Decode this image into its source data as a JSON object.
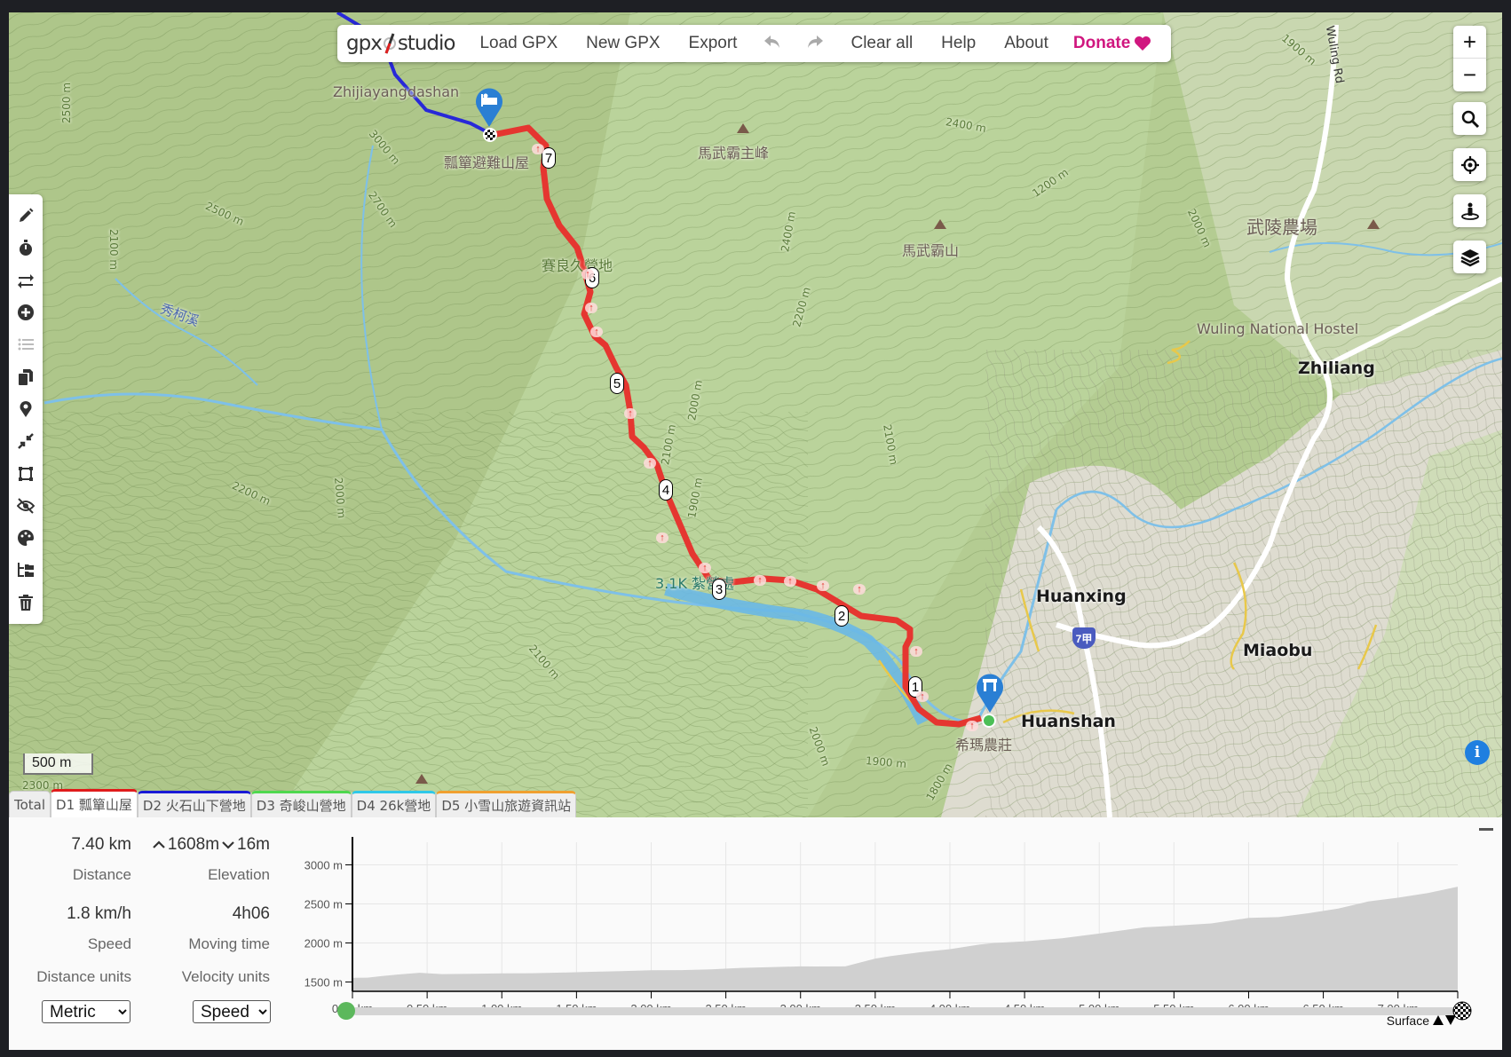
{
  "app": {
    "name_left": "gpx",
    "name_right": "studio"
  },
  "menu": {
    "load": "Load GPX",
    "new": "New GPX",
    "export": "Export",
    "undo_icon": "undo-icon",
    "redo_icon": "redo-icon",
    "clear": "Clear all",
    "help": "Help",
    "about": "About",
    "donate": "Donate",
    "donate_icon": "heart-icon",
    "donate_color": "#d0177f"
  },
  "toolbar": [
    {
      "name": "pencil-icon",
      "label": "Edit route"
    },
    {
      "name": "stopwatch-icon",
      "label": "Time"
    },
    {
      "name": "reverse-icon",
      "label": "Reverse"
    },
    {
      "name": "add-circle-icon",
      "label": "Add"
    },
    {
      "name": "list-icon",
      "label": "List",
      "disabled": true
    },
    {
      "name": "copy-icon",
      "label": "Duplicate"
    },
    {
      "name": "map-pin-icon",
      "label": "Waypoint"
    },
    {
      "name": "compress-icon",
      "label": "Reduce"
    },
    {
      "name": "crop-icon",
      "label": "Crop"
    },
    {
      "name": "eye-slash-icon",
      "label": "Hide"
    },
    {
      "name": "palette-icon",
      "label": "Style"
    },
    {
      "name": "folder-tree-icon",
      "label": "Structure"
    },
    {
      "name": "trash-icon",
      "label": "Delete"
    }
  ],
  "map_controls": {
    "zoom_in": "+",
    "zoom_out": "−",
    "search_icon": "search-icon",
    "locate_icon": "locate-icon",
    "streetview_icon": "person-icon",
    "layers_icon": "layers-icon",
    "info_icon": "i"
  },
  "scale": "500 m",
  "map_labels": {
    "zhijiayangdashan": "Zhijiayangdashan",
    "hut": "瓢簞避難山屋",
    "mawuba_main": "馬武霸主峰",
    "mawuba": "馬武霸山",
    "wuling_farm": "武陵農場",
    "wuling_hostel": "Wuling National Hostel",
    "zhiliang": "Zhiliang",
    "huanxing": "Huanxing",
    "miaobu": "Miaobu",
    "huanshan": "Huanshan",
    "ximanongzhuang": "希瑪農莊",
    "sailiang_camp": "賽良久營地",
    "km31": "3.1K 紮營處",
    "xiukexi": "秀柯溪",
    "wuling_rd": "Wuling Rd",
    "hwy": "7甲",
    "contours": [
      "2500 m",
      "3000 m",
      "2700 m",
      "2500 m",
      "2100 m",
      "2400 m",
      "1200 m",
      "2000 m",
      "2400 m",
      "2200 m",
      "2000 m",
      "2100 m",
      "1900 m",
      "2100 m",
      "2200 m",
      "2000 m",
      "2100 m",
      "2000 m",
      "1900 m",
      "1800 m",
      "1900 m",
      "2300 m"
    ]
  },
  "route_markers": [
    "1",
    "2",
    "3",
    "4",
    "5",
    "6",
    "7"
  ],
  "tabs": [
    {
      "label": "Total",
      "color": null
    },
    {
      "label": "D1 瓢簞山屋",
      "color": "#e01b1b",
      "active": true
    },
    {
      "label": "D2 火石山下營地",
      "color": "#1a1ad6"
    },
    {
      "label": "D3 奇峻山營地",
      "color": "#4ed84e"
    },
    {
      "label": "D4 26k營地",
      "color": "#2fc8e8"
    },
    {
      "label": "D5 小雪山旅遊資訊站",
      "color": "#f0a030"
    }
  ],
  "stats": {
    "distance": "7.40 km",
    "distance_label": "Distance",
    "elev_up": "1608m",
    "elev_down": "16m",
    "elevation_label": "Elevation",
    "speed": "1.8 km/h",
    "speed_label": "Speed",
    "moving_time": "4h06",
    "moving_time_label": "Moving time",
    "distance_units_label": "Distance units",
    "velocity_units_label": "Velocity units",
    "distance_units_value": "Metric",
    "velocity_units_value": "Speed"
  },
  "surface_label": "Surface",
  "chart_data": {
    "type": "area",
    "title": "",
    "xlabel": "",
    "ylabel": "",
    "x_unit": "km",
    "y_unit": "m",
    "xlim": [
      0,
      7.4
    ],
    "ylim": [
      1380,
      3290
    ],
    "xticks": [
      0,
      0.5,
      1,
      1.5,
      2,
      2.5,
      3,
      3.5,
      4,
      4.5,
      5,
      5.5,
      6,
      6.5,
      7
    ],
    "xtick_labels": [
      "0.00 km",
      "0.50 km",
      "1.00 km",
      "1.50 km",
      "2.00 km",
      "2.50 km",
      "3.00 km",
      "3.50 km",
      "4.00 km",
      "4.50 km",
      "5.00 km",
      "5.50 km",
      "6.00 km",
      "6.50 km",
      "7.00 km"
    ],
    "yticks": [
      1500,
      2000,
      2500,
      3000
    ],
    "ytick_labels": [
      "1500 m",
      "2000 m",
      "2500 m",
      "3000 m"
    ],
    "grid": true,
    "legend": "none",
    "x": [
      0,
      0.1,
      0.2,
      0.3,
      0.45,
      0.6,
      0.8,
      1.0,
      1.2,
      1.4,
      1.6,
      1.8,
      2.0,
      2.2,
      2.4,
      2.6,
      2.8,
      3.0,
      3.1,
      3.3,
      3.4,
      3.5,
      3.6,
      3.8,
      4.0,
      4.2,
      4.3,
      4.5,
      4.75,
      5.0,
      5.3,
      5.5,
      5.75,
      6.0,
      6.2,
      6.4,
      6.6,
      6.8,
      7.0,
      7.2,
      7.4
    ],
    "y": [
      1553,
      1555,
      1575,
      1595,
      1618,
      1600,
      1605,
      1610,
      1612,
      1620,
      1630,
      1638,
      1650,
      1652,
      1662,
      1680,
      1690,
      1700,
      1698,
      1700,
      1750,
      1800,
      1830,
      1880,
      1920,
      1980,
      2000,
      2020,
      2060,
      2120,
      2200,
      2220,
      2250,
      2320,
      2330,
      2380,
      2440,
      2530,
      2580,
      2640,
      2720
    ]
  }
}
